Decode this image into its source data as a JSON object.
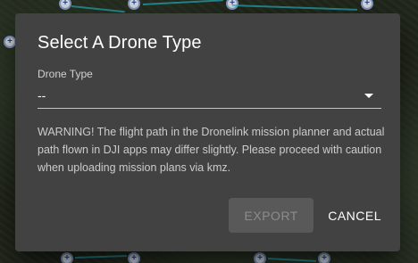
{
  "dialog": {
    "title": "Select A Drone Type",
    "drone_type": {
      "label": "Drone Type",
      "value": "--",
      "arrow_icon": "dropdown-arrow-icon"
    },
    "warning": "WARNING! The flight path in the Dronelink mission planner and actual path flown in DJI apps may differ slightly. Please proceed with caution when uploading mission plans via kmz.",
    "buttons": {
      "export": "EXPORT",
      "cancel": "CANCEL"
    }
  },
  "colors": {
    "dialog_bg": "#424242",
    "text": "#ffffff",
    "disabled_button_bg": "#555555",
    "route": "#27b5c4"
  }
}
